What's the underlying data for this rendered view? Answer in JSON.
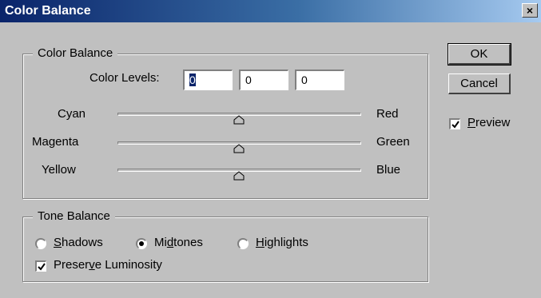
{
  "window": {
    "title": "Color Balance",
    "close_glyph": "×"
  },
  "color_balance": {
    "group_label": "Color Balance",
    "levels_label": "Color Levels:",
    "levels": [
      "0",
      "0",
      "0"
    ],
    "sliders": [
      {
        "left": "Cyan",
        "right": "Red",
        "value": 0
      },
      {
        "left": "Magenta",
        "right": "Green",
        "value": 0
      },
      {
        "left": "Yellow",
        "right": "Blue",
        "value": 0
      }
    ]
  },
  "tone_balance": {
    "group_label": "Tone Balance",
    "options": [
      {
        "label": "Shadows",
        "selected": false
      },
      {
        "label": "Midtones",
        "selected": true
      },
      {
        "label": "Highlights",
        "selected": false
      }
    ],
    "preserve_label": "Preserve Luminosity",
    "preserve_checked": true
  },
  "buttons": {
    "ok": "OK",
    "cancel": "Cancel"
  },
  "preview": {
    "label": "Preview",
    "checked": true
  }
}
